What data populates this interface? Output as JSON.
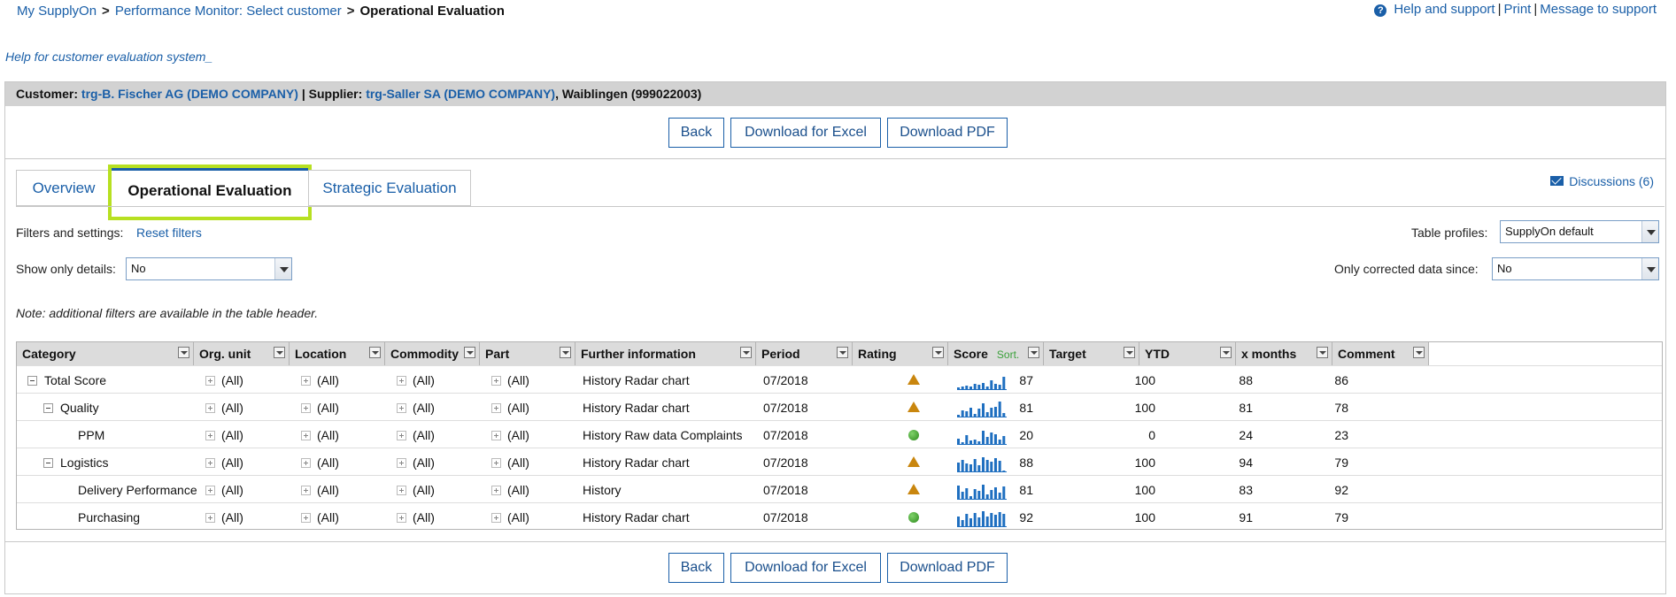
{
  "breadcrumb": {
    "home": "My SupplyOn",
    "parent": "Performance Monitor: Select customer",
    "current": "Operational Evaluation",
    "separator": ">"
  },
  "top_links": {
    "help": "Help and support",
    "print": "Print",
    "message": "Message to support",
    "pipe": "|"
  },
  "help_system": "Help for customer evaluation system_",
  "customer_bar": {
    "customer_label": "Customer:",
    "customer_name": "trg-B. Fischer AG (DEMO COMPANY)",
    "pipe": "|",
    "supplier_label": "Supplier:",
    "supplier_name": "trg-Saller SA (DEMO COMPANY)",
    "supplier_location": ", Waiblingen (999022003)"
  },
  "buttons": {
    "back": "Back",
    "excel": "Download for Excel",
    "pdf": "Download PDF"
  },
  "tabs": [
    {
      "label": "Overview",
      "active": false
    },
    {
      "label": "Operational Evaluation",
      "active": true
    },
    {
      "label": "Strategic Evaluation",
      "active": false
    }
  ],
  "discussions": "Discussions (6)",
  "filters": {
    "label": "Filters and settings:",
    "reset": "Reset filters",
    "show_details_label": "Show only details:",
    "show_details_value": "No",
    "table_profiles_label": "Table profiles:",
    "table_profiles_value": "SupplyOn default",
    "corrected_label": "Only corrected data since:",
    "corrected_value": "No"
  },
  "note": "Note: additional filters are available in the table header.",
  "table": {
    "columns": [
      "Category",
      "Org. unit",
      "Location",
      "Commodity",
      "Part",
      "Further information",
      "Period",
      "Rating",
      "Score",
      "Target",
      "YTD",
      "x months",
      "Comment"
    ],
    "sort_label": "Sort.",
    "rows": [
      {
        "category": "Total Score",
        "level": 0,
        "toggle": "minus",
        "org": "(All)",
        "loc": "(All)",
        "com": "(All)",
        "part": "(All)",
        "info": "History Radar chart",
        "period": "07/2018",
        "rating": "triangle",
        "score": "87",
        "target": "100",
        "ytd": "88",
        "xm": "86",
        "spark": [
          0.15,
          0.2,
          0.25,
          0.2,
          0.35,
          0.3,
          0.4,
          0.2,
          0.55,
          0.35,
          0.3,
          0.75
        ]
      },
      {
        "category": "Quality",
        "level": 1,
        "toggle": "minus",
        "org": "(All)",
        "loc": "(All)",
        "com": "(All)",
        "part": "(All)",
        "info": "History Radar chart",
        "period": "07/2018",
        "rating": "triangle",
        "score": "81",
        "target": "100",
        "ytd": "81",
        "xm": "78",
        "spark": [
          0.15,
          0.4,
          0.35,
          0.55,
          0.2,
          0.5,
          0.8,
          0.3,
          0.55,
          0.6,
          0.9,
          0.25
        ]
      },
      {
        "category": "PPM",
        "level": 2,
        "toggle": "none",
        "org": "(All)",
        "loc": "(All)",
        "com": "(All)",
        "part": "(All)",
        "info": "History Raw data Complaints",
        "period": "07/2018",
        "rating": "dot",
        "score": "20",
        "target": "0",
        "ytd": "24",
        "xm": "23",
        "spark": [
          0.35,
          0.15,
          0.55,
          0.25,
          0.3,
          0.2,
          0.8,
          0.45,
          0.7,
          0.6,
          0.3,
          0.5
        ]
      },
      {
        "category": "Logistics",
        "level": 1,
        "toggle": "minus",
        "org": "(All)",
        "loc": "(All)",
        "com": "(All)",
        "part": "(All)",
        "info": "History Radar chart",
        "period": "07/2018",
        "rating": "triangle",
        "score": "88",
        "target": "100",
        "ytd": "94",
        "xm": "79",
        "spark": [
          0.55,
          0.7,
          0.5,
          0.45,
          0.75,
          0.4,
          0.85,
          0.7,
          0.6,
          0.8,
          0.65,
          0.1
        ]
      },
      {
        "category": "Delivery Performance",
        "level": 2,
        "toggle": "none",
        "org": "(All)",
        "loc": "(All)",
        "com": "(All)",
        "part": "(All)",
        "info": "History",
        "period": "07/2018",
        "rating": "triangle",
        "score": "81",
        "target": "100",
        "ytd": "83",
        "xm": "92",
        "spark": [
          0.8,
          0.45,
          0.65,
          0.2,
          0.6,
          0.5,
          0.85,
          0.3,
          0.55,
          0.7,
          0.4,
          0.75
        ]
      },
      {
        "category": "Purchasing",
        "level": 2,
        "toggle": "none",
        "org": "(All)",
        "loc": "(All)",
        "com": "(All)",
        "part": "(All)",
        "info": "History Radar chart",
        "period": "07/2018",
        "rating": "dot",
        "score": "92",
        "target": "100",
        "ytd": "91",
        "xm": "79",
        "spark": [
          0.6,
          0.4,
          0.75,
          0.5,
          0.8,
          0.55,
          0.9,
          0.6,
          0.8,
          0.7,
          0.85,
          0.75
        ]
      }
    ]
  },
  "colors": {
    "link": "#1a5fa8",
    "tab_highlight": "#b7e021",
    "rating_triangle": "#c9860e",
    "rating_dot": "#2d8a1d",
    "spark": "#1f6fc0"
  }
}
